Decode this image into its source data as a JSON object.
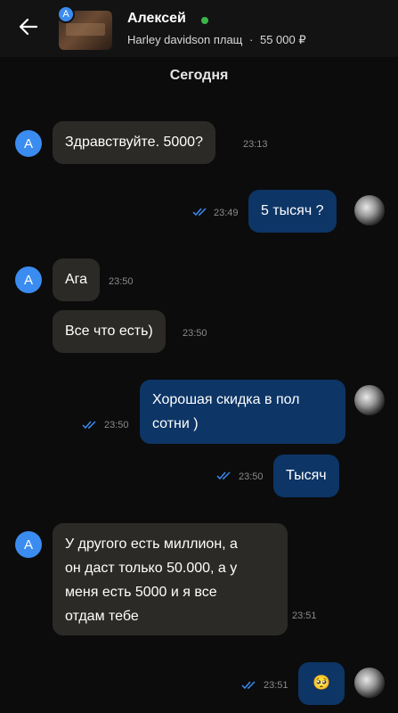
{
  "header": {
    "contact_name": "Алексей",
    "avatar_letter": "A",
    "listing_title": "Harley davidson плащ",
    "listing_separator": "·",
    "listing_price": "55 000 ₽",
    "online_color": "#3bb54a"
  },
  "date_separator": "Сегодня",
  "messages": [
    {
      "from": "them",
      "text": "Здравствуйте. 5000?",
      "time": "23:13"
    },
    {
      "from": "me",
      "text": "5 тысяч ?",
      "time": "23:49",
      "read": true
    },
    {
      "from": "them",
      "text": "Ага",
      "time": "23:50"
    },
    {
      "from": "them",
      "text": "Все что есть)",
      "time": "23:50"
    },
    {
      "from": "me",
      "lines": [
        "Хорошая скидка в пол",
        "сотни )"
      ],
      "time": "23:50",
      "read": true
    },
    {
      "from": "me",
      "text": "Тысяч",
      "time": "23:50",
      "read": true
    },
    {
      "from": "them",
      "lines": [
        "У другого есть миллион, а",
        "он даст только 50.000, а у",
        "меня есть 5000 и я все",
        "отдам тебе"
      ],
      "time": "23:51"
    },
    {
      "from": "me",
      "text": "🥺",
      "time": "23:51",
      "read": true
    }
  ],
  "colors": {
    "background": "#0c0c0d",
    "incoming_bubble": "#2c2a26",
    "outgoing_bubble": "#0d3566",
    "accent": "#3b8cf0"
  }
}
